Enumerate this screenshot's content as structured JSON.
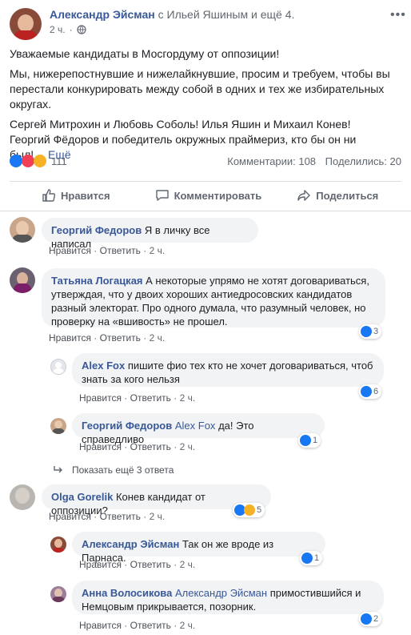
{
  "post": {
    "author": "Александр Эйсман",
    "with_text": "с Ильей Яшиным и ещё 4.",
    "time": "2 ч.",
    "p1": "Уважаемые кандидаты в Мосгордуму от оппозиции!",
    "p2": "Мы, нижерепостнувшие и нижелайкнувшие, просим и требуем, чтобы вы перестали конкурировать между собой в одних и тех же избирательных округах.",
    "p3": "Сергей Митрохин и Любовь Соболь! Илья Яшин и Михаил Конев! Георгий Фёдоров и победитель окружных праймериз, кто бы он ни был!…",
    "more": "Ещё",
    "reactions_count": "111",
    "comments_count": "Комментарии: 108",
    "shares_count": "Поделились: 20"
  },
  "buttons": {
    "like": "Нравится",
    "comment": "Комментировать",
    "share": "Поделиться"
  },
  "colors": {
    "link": "#385898",
    "like_blue": "#1877f2",
    "haha": "#f7b125",
    "love": "#f33e58"
  },
  "comments": [
    {
      "name": "Георгий Федоров",
      "text": "Я в личку все написал",
      "like": "Нравится",
      "reply": "Ответить",
      "time": "2 ч."
    },
    {
      "name": "Татьяна Логацкая",
      "text": "А некоторые упрямо не хотят договариваться, утверждая, что у двоих хороших антиедросовских кандидатов разный электорат. Про одного думала, что разумный человек, но проверку на «вшивость» не прошел.",
      "like": "Нравится",
      "reply": "Ответить",
      "time": "2 ч.",
      "reactions": "3",
      "replies": [
        {
          "name": "Alex Fox",
          "text": "пишите фио тех кто не хочет договариваться, чтоб знать за кого нельзя",
          "like": "Нравится",
          "reply": "Ответить",
          "time": "2 ч.",
          "reactions": "6"
        },
        {
          "name": "Георгий Федоров",
          "mention": "Alex Fox",
          "text": "да! Это справедливо",
          "like": "Нравится",
          "reply": "Ответить",
          "time": "2 ч.",
          "reactions": "1"
        }
      ],
      "more_replies": "Показать ещё 3 ответа"
    },
    {
      "name": "Olga Gorelik",
      "text": "Конев кандидат от оппозиции?",
      "like": "Нравится",
      "reply": "Ответить",
      "time": "2 ч.",
      "reactions": "5",
      "replies": [
        {
          "name": "Александр Эйсман",
          "text": "Так он же вроде из Парнаса.",
          "like": "Нравится",
          "reply": "Ответить",
          "time": "2 ч.",
          "reactions": "1"
        },
        {
          "name": "Анна Волосикова",
          "mention": "Александр Эйсман",
          "text": "примостившийся и Немцовым прикрывается, позорник.",
          "like": "Нравится",
          "reply": "Ответить",
          "time": "2 ч.",
          "reactions": "2"
        }
      ]
    }
  ]
}
